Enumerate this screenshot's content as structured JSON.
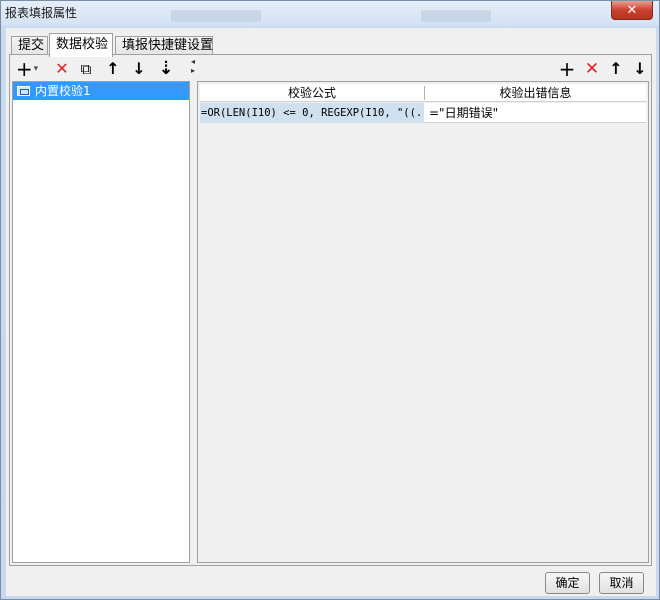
{
  "window": {
    "title": "报表填报属性",
    "close_glyph": "✕"
  },
  "tabs": [
    {
      "label": "提交"
    },
    {
      "label": "数据校验",
      "active": true
    },
    {
      "label": "填报快捷键设置"
    }
  ],
  "left_toolbar": {
    "add_icon": "+",
    "add_dropdown_icon": "▾",
    "delete_icon": "✕",
    "copy_icon": "⧉",
    "up_icon": "↑",
    "down_icon": "↓",
    "sort_icon": "⇣"
  },
  "left_list": {
    "items": [
      {
        "label": "内置校验1",
        "selected": true
      }
    ]
  },
  "right_toolbar": {
    "add_icon": "+",
    "delete_icon": "✕",
    "up_icon": "↑",
    "down_icon": "↓"
  },
  "grid": {
    "headers": [
      "校验公式",
      "校验出错信息"
    ],
    "rows": [
      {
        "formula": "=OR(LEN(I10) <= 0, REGEXP(I10, \"((...",
        "message": "=\"日期错误\""
      }
    ]
  },
  "footer": {
    "ok_label": "确定",
    "cancel_label": "取消"
  },
  "colors": {
    "selection": "#3399ff",
    "delete_red": "#e02020",
    "formula_cell_bg": "#cfe0ef"
  }
}
